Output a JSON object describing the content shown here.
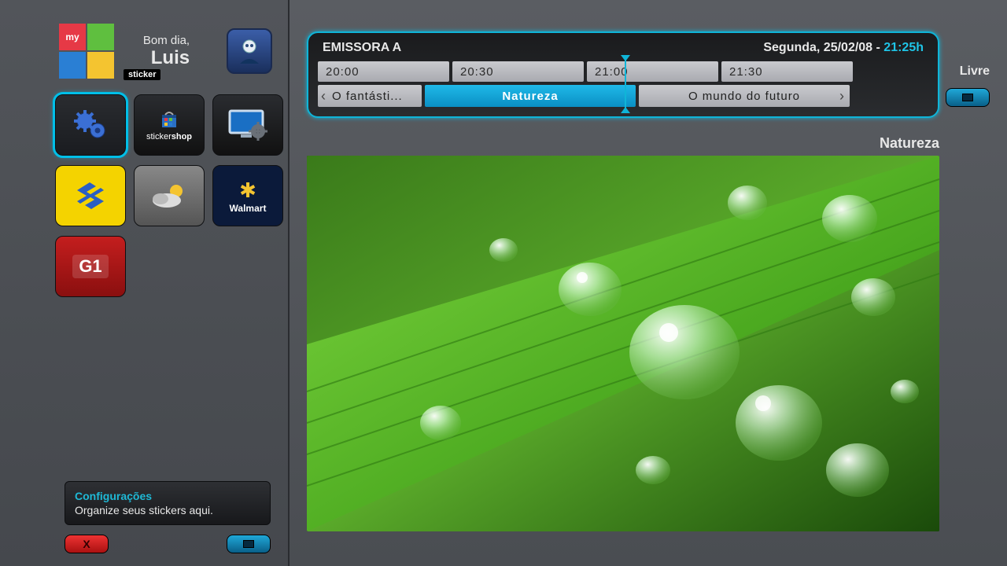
{
  "header": {
    "logo_top": "my",
    "logo_label": "sticker",
    "greeting": "Bom dia,",
    "username": "Luis"
  },
  "apps": {
    "settings": "Configurações",
    "stickershop_prefix": "sticker",
    "stickershop_suffix": "shop",
    "walmart": "Walmart",
    "g1": "G1"
  },
  "info": {
    "title": "Configurações",
    "text": "Organize seus stickers aqui."
  },
  "close_label": "X",
  "epg": {
    "channel": "EMISSORA A",
    "date": "Segunda, 25/02/08",
    "sep": " - ",
    "clock": "21:25h",
    "status": "Livre",
    "slots": [
      "20:00",
      "20:30",
      "21:00",
      "21:30"
    ],
    "programs": {
      "prev": "O fantásti...",
      "current": "Natureza",
      "next": "O mundo do futuro"
    }
  },
  "program_title": "Natureza"
}
